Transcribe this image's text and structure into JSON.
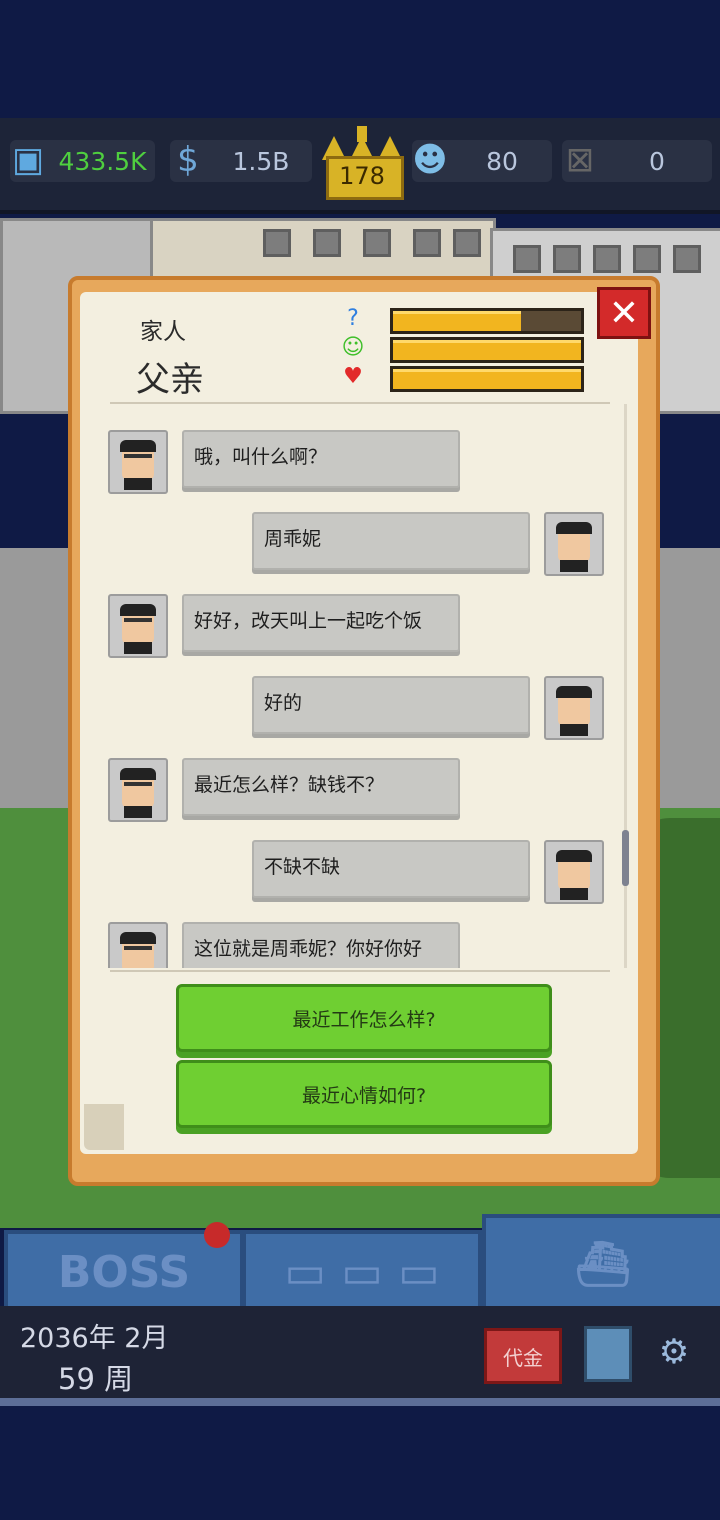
{
  "stats": {
    "employees": "433.5K",
    "money": "1.5B",
    "crown_level": "178",
    "mood": "80",
    "box": "0"
  },
  "colors": {
    "employees_text": "#4fcf3f",
    "bar_fill": "#f2b51f",
    "option_green": "#6fcf32",
    "close_red": "#d32a2a"
  },
  "dialog": {
    "category": "家人",
    "name": "父亲",
    "bars": [
      {
        "icon": "question-bubble-icon",
        "symbol": "?",
        "level": 0.68
      },
      {
        "icon": "smile-icon",
        "symbol": "☺",
        "level": 1.0
      },
      {
        "icon": "hearts-icon",
        "symbol": "♥",
        "level": 1.0
      }
    ],
    "messages": [
      {
        "from": "father",
        "text": "哦，叫什么啊？"
      },
      {
        "from": "me",
        "text": "周乖妮"
      },
      {
        "from": "father",
        "text": "好好，改天叫上一起吃个饭"
      },
      {
        "from": "me",
        "text": "好的"
      },
      {
        "from": "father",
        "text": "最近怎么样？缺钱不？"
      },
      {
        "from": "me",
        "text": "不缺不缺"
      },
      {
        "from": "father",
        "text": "这位就是周乖妮？你好你好"
      }
    ],
    "options": [
      "最近工作怎么样?",
      "最近心情如何?"
    ],
    "close_symbol": "✕"
  },
  "bottom": {
    "date_line1": "2036年 2月",
    "date_line2": "59 周",
    "boss_label": "BOSS",
    "red_button_label": "代金"
  }
}
